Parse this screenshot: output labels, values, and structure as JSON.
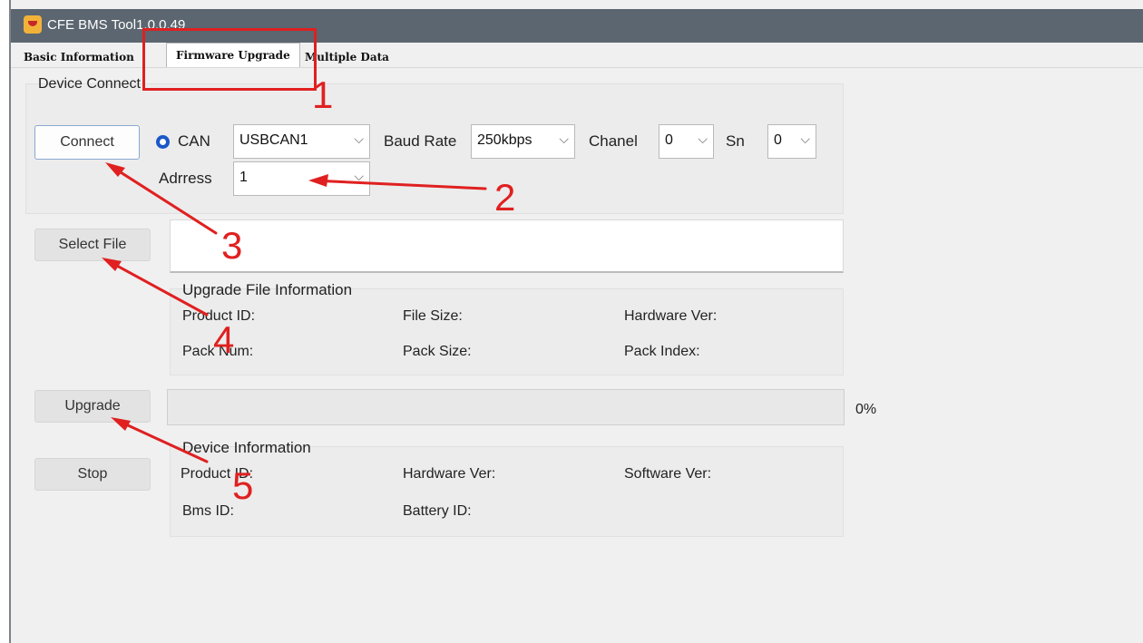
{
  "window": {
    "title": "CFE BMS Tool1.0.0.49"
  },
  "tabs": [
    "Basic Information",
    "Firmware Upgrade",
    "Multiple Data"
  ],
  "device_connect": {
    "title": "Device Connect",
    "connect_label": "Connect",
    "interface_label": "CAN",
    "interface_selected": true,
    "can_device": "USBCAN1",
    "baud_rate_label": "Baud Rate",
    "baud_rate": "250kbps",
    "channel_label": "Chanel",
    "channel": "0",
    "sn_label": "Sn",
    "sn": "0",
    "address_label": "Adrress",
    "address": "1"
  },
  "file": {
    "select_label": "Select File",
    "path": ""
  },
  "upgrade_file_info": {
    "title": "Upgrade File Information",
    "product_id_label": "Product ID:",
    "file_size_label": "File Size:",
    "hardware_ver_label": "Hardware Ver:",
    "pack_num_label": "Pack Num:",
    "pack_size_label": "Pack Size:",
    "pack_index_label": "Pack Index:"
  },
  "upgrade": {
    "upgrade_label": "Upgrade",
    "stop_label": "Stop",
    "progress_text": "0%",
    "progress_value": 0
  },
  "device_info": {
    "title": "Device Information",
    "product_id_label": "Product ID:",
    "hardware_ver_label": "Hardware Ver:",
    "software_ver_label": "Software Ver:",
    "bms_id_label": "Bms ID:",
    "battery_id_label": "Battery ID:"
  },
  "annotations": {
    "color": "#e02020",
    "numbers": [
      "1",
      "2",
      "3",
      "4",
      "5"
    ]
  },
  "icons": {
    "app": "bms-app-icon",
    "dropdown": "chevron-down-icon",
    "arrow": "red-arrow"
  }
}
